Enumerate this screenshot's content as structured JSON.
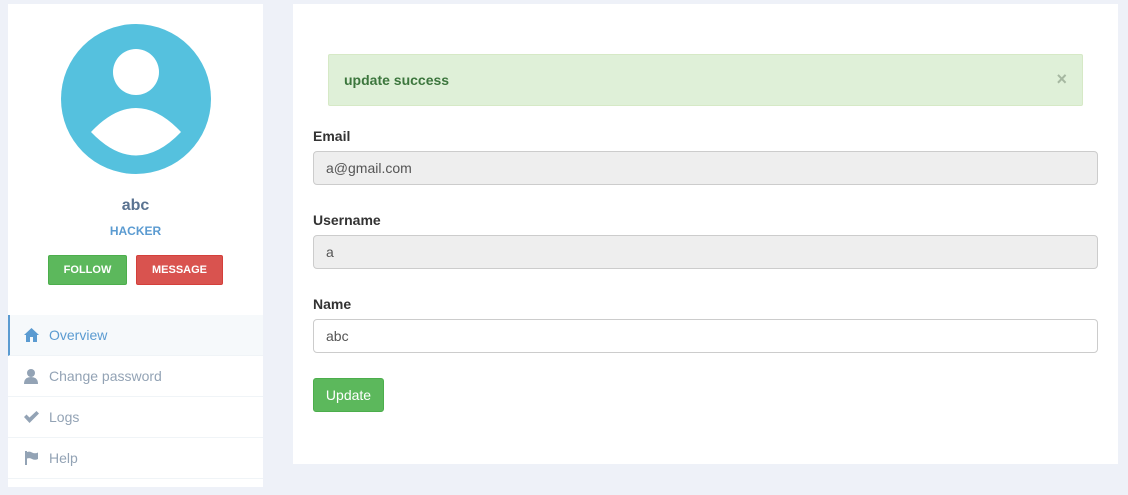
{
  "profile": {
    "name": "abc",
    "role": "HACKER",
    "follow_label": "FOLLOW",
    "message_label": "MESSAGE",
    "avatar_color": "#55c1de"
  },
  "menu": {
    "items": [
      {
        "label": "Overview",
        "icon": "home-icon",
        "active": true
      },
      {
        "label": "Change password",
        "icon": "user-icon",
        "active": false
      },
      {
        "label": "Logs",
        "icon": "check-icon",
        "active": false
      },
      {
        "label": "Help",
        "icon": "flag-icon",
        "active": false
      }
    ]
  },
  "alert": {
    "message": "update success",
    "close_glyph": "×"
  },
  "form": {
    "email_label": "Email",
    "email_value": "a@gmail.com",
    "username_label": "Username",
    "username_value": "a",
    "name_label": "Name",
    "name_value": "abc",
    "update_label": "Update"
  },
  "colors": {
    "success": "#5cb85c",
    "danger": "#d9534f",
    "accent": "#5b9bd1"
  }
}
